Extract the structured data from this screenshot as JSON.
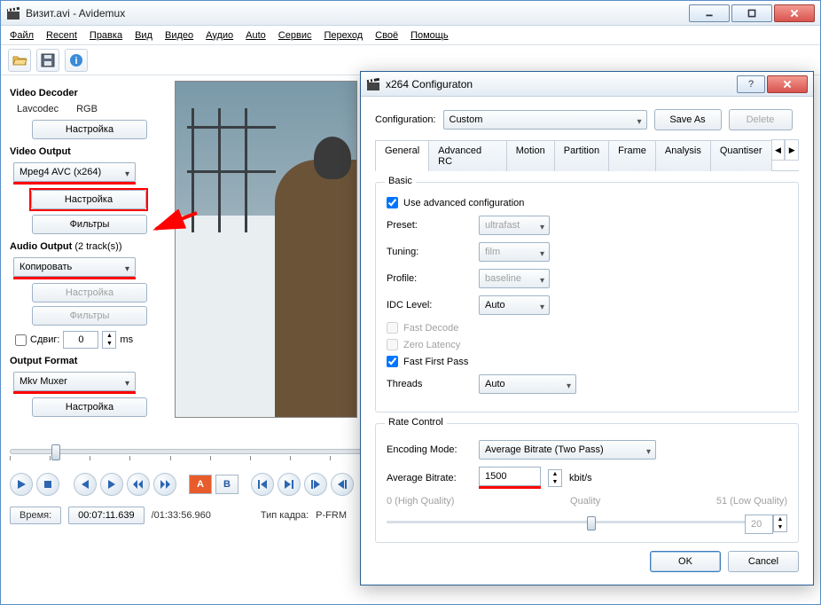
{
  "window": {
    "title": "Визит.avi - Avidemux",
    "menu": [
      "Файл",
      "Recent",
      "Правка",
      "Вид",
      "Видео",
      "Аудио",
      "Auto",
      "Сервис",
      "Переход",
      "Своё",
      "Помощь"
    ]
  },
  "side": {
    "video_decoder_label": "Video Decoder",
    "lavcodec": "Lavcodec",
    "rgb": "RGB",
    "config_btn": "Настройка",
    "video_output_label": "Video Output",
    "video_output_value": "Mpeg4 AVC (x264)",
    "filters_btn": "Фильтры",
    "audio_output_label": "Audio Output",
    "audio_tracks": "(2 track(s))",
    "audio_output_value": "Копировать",
    "shift_label": "Сдвиг:",
    "shift_value": "0",
    "shift_unit": "ms",
    "output_format_label": "Output Format",
    "output_format_value": "Mkv Muxer"
  },
  "status": {
    "time_label": "Время:",
    "time_value": "00:07:11.639",
    "total": "/01:33:56.960",
    "frame_type_label": "Тип кадра:",
    "frame_type_value": "P-FRM"
  },
  "dialog": {
    "title": "x264 Configuraton",
    "config_label": "Configuration:",
    "config_value": "Custom",
    "save_as": "Save As",
    "delete": "Delete",
    "tabs": [
      "General",
      "Advanced RC",
      "Motion",
      "Partition",
      "Frame",
      "Analysis",
      "Quantiser"
    ],
    "basic_legend": "Basic",
    "use_advanced": "Use advanced configuration",
    "preset_label": "Preset:",
    "preset_value": "ultrafast",
    "tuning_label": "Tuning:",
    "tuning_value": "film",
    "profile_label": "Profile:",
    "profile_value": "baseline",
    "idc_label": "IDC Level:",
    "idc_value": "Auto",
    "fast_decode": "Fast Decode",
    "zero_latency": "Zero Latency",
    "fast_first_pass": "Fast First Pass",
    "threads_label": "Threads",
    "threads_value": "Auto",
    "rate_legend": "Rate Control",
    "enc_mode_label": "Encoding Mode:",
    "enc_mode_value": "Average Bitrate (Two Pass)",
    "avg_bitrate_label": "Average Bitrate:",
    "avg_bitrate_value": "1500",
    "kbits": "kbit/s",
    "q_high": "0 (High Quality)",
    "q_label": "Quality",
    "q_low": "51 (Low Quality)",
    "q_value": "20",
    "ok": "OK",
    "cancel": "Cancel"
  }
}
